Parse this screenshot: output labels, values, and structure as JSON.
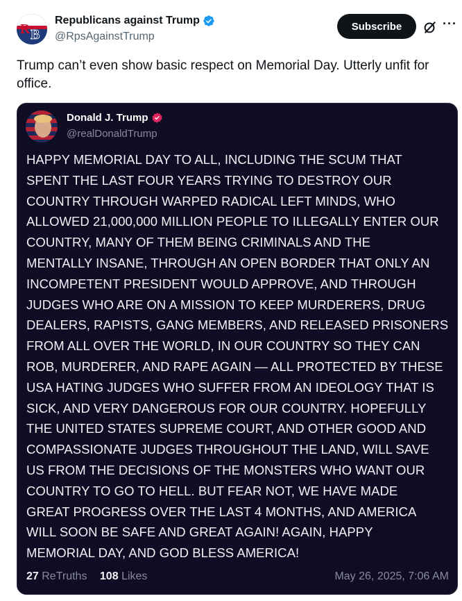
{
  "author": {
    "display_name": "Republicans against Trump",
    "handle": "@RpsAgainstTrump",
    "avatar_letters": "RB"
  },
  "actions": {
    "subscribe_label": "Subscribe",
    "more_label": "···"
  },
  "tweet": {
    "text": "Trump can’t even show basic respect on Memorial Day. Utterly unfit for office."
  },
  "quoted_post": {
    "display_name": "Donald J. Trump",
    "handle": "@realDonaldTrump",
    "text_lines": [
      "HAPPY MEMORIAL DAY TO ALL, INCLUDING THE SCUM THAT",
      "SPENT THE LAST FOUR YEARS TRYING TO DESTROY OUR",
      "COUNTRY THROUGH WARPED RADICAL LEFT MINDS, WHO",
      "ALLOWED 21,000,000 MILLION PEOPLE TO ILLEGALLY ENTER OUR",
      "COUNTRY, MANY OF THEM BEING CRIMINALS AND THE",
      "MENTALLY INSANE, THROUGH AN OPEN BORDER THAT ONLY AN",
      "INCOMPETENT PRESIDENT WOULD APPROVE, AND THROUGH",
      "JUDGES WHO ARE ON A MISSION TO KEEP MURDERERS, DRUG",
      "DEALERS, RAPISTS, GANG MEMBERS, AND RELEASED PRISONERS",
      "FROM ALL OVER THE WORLD, IN OUR COUNTRY SO THEY CAN",
      "ROB, MURDERER, AND RAPE AGAIN — ALL PROTECTED BY THESE",
      "USA HATING JUDGES WHO SUFFER FROM AN IDEOLOGY THAT IS",
      "SICK, AND VERY DANGEROUS FOR OUR COUNTRY. HOPEFULLY",
      "THE UNITED STATES SUPREME COURT, AND OTHER GOOD AND",
      "COMPASSIONATE JUDGES THROUGHOUT THE LAND, WILL SAVE",
      "US FROM THE DECISIONS OF THE MONSTERS WHO WANT OUR",
      "COUNTRY TO GO TO HELL. BUT FEAR NOT, WE HAVE MADE",
      "GREAT PROGRESS OVER THE LAST 4 MONTHS, AND AMERICA",
      "WILL SOON BE SAFE AND GREAT AGAIN! AGAIN, HAPPY",
      "MEMORIAL DAY, AND GOD BLESS AMERICA!"
    ],
    "retruths_count": "27",
    "retruths_label": "ReTruths",
    "likes_count": "108",
    "likes_label": "Likes",
    "timestamp": "May 26, 2025, 7:06 AM"
  },
  "colors": {
    "verified_blue": "#1d9bf0",
    "truth_badge_red": "#e0245e",
    "quote_background": "#0f0d24"
  },
  "icons": [
    "verified-badge-icon",
    "grok-icon",
    "more-options-icon",
    "truth-verified-badge-icon"
  ]
}
